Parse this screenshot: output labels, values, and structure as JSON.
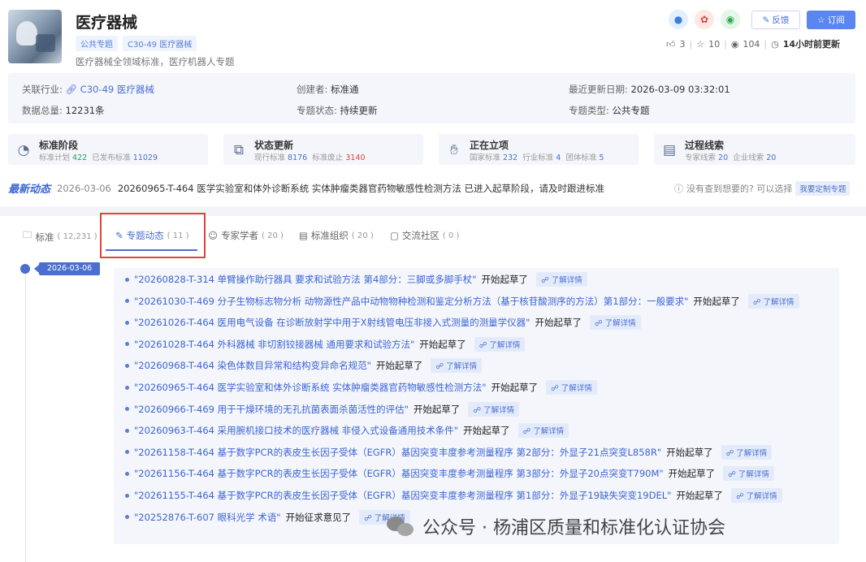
{
  "header": {
    "title": "医疗器械",
    "tags": [
      "公共专题",
      "C30-49 医疗器械"
    ],
    "subtitle": "医疗器械全领域标准，医疗机器人专题",
    "feedback_label": "反馈",
    "subscribe_label": "订阅",
    "likes": "3",
    "stars": "10",
    "views": "104",
    "updated": "14小时前更新"
  },
  "info": {
    "industry_label": "关联行业:",
    "industry_value": "C30-49 医疗器械",
    "creator_label": "创建者:",
    "creator_value": "标准通",
    "last_update_label": "最近更新日期:",
    "last_update_value": "2026-03-09 03:32:01",
    "total_label": "数据总量:",
    "total_value": "12231条",
    "status_label": "专题状态:",
    "status_value": "持续更新",
    "type_label": "专题类型:",
    "type_value": "公共专题"
  },
  "cards": [
    {
      "title": "标准阶段",
      "a_label": "标准计划",
      "a_value": "422",
      "b_label": "已发布标准",
      "b_value": "11029",
      "icon": "pie-chart-icon"
    },
    {
      "title": "状态更新",
      "a_label": "现行标准",
      "a_value": "8176",
      "b_label": "标准废止",
      "b_value": "3140",
      "icon": "switch-icon"
    },
    {
      "title": "正在立项",
      "a_label": "国家标准",
      "a_value": "232",
      "b_label": "行业标准",
      "b_value": "4",
      "c_label": "团体标准",
      "c_value": "5",
      "icon": "hand-icon"
    },
    {
      "title": "过程线索",
      "a_label": "专家线索",
      "a_value": "20",
      "b_label": "企业线索",
      "b_value": "20",
      "icon": "clue-icon"
    }
  ],
  "news": {
    "label": "最新动态",
    "date": "2026-03-06",
    "text": "20260965-T-464 医学实验室和体外诊断系统 实体肿瘤类器官药物敏感性检测方法 已进入起草阶段，请及时跟进标准",
    "help": "没有查到想要的? 可以选择",
    "custom": "我要定制专题"
  },
  "tabs": [
    {
      "label": "标准",
      "count": "( 12,231 )"
    },
    {
      "label": "专题动态",
      "count": "( 11 )"
    },
    {
      "label": "专家学者",
      "count": "( 20 )"
    },
    {
      "label": "标准组织",
      "count": "( 20 )"
    },
    {
      "label": "交流社区",
      "count": "( 0 )"
    }
  ],
  "timeline": {
    "date": "2026-03-06",
    "more_label": "了解详情",
    "items": [
      {
        "name": "\"20260828-T-314 单臂操作助行器具 要求和试验方法 第4部分：三脚或多脚手杖\"",
        "action": "开始起草了"
      },
      {
        "name": "\"20261030-T-469 分子生物标志物分析 动物源性产品中动物物种检测和鉴定分析方法（基于核苷酸测序的方法）第1部分：一般要求\"",
        "action": "开始起草了"
      },
      {
        "name": "\"20261026-T-464 医用电气设备 在诊断放射学中用于X射线管电压非接入式测量的测量学仪器\"",
        "action": "开始起草了"
      },
      {
        "name": "\"20261028-T-464 外科器械 非切割铰接器械 通用要求和试验方法\"",
        "action": "开始起草了"
      },
      {
        "name": "\"20260968-T-464 染色体数目异常和结构变异命名规范\"",
        "action": "开始起草了"
      },
      {
        "name": "\"20260965-T-464 医学实验室和体外诊断系统 实体肿瘤类器官药物敏感性检测方法\"",
        "action": "开始起草了"
      },
      {
        "name": "\"20260966-T-469 用于干燥环境的无孔抗菌表面杀菌活性的评估\"",
        "action": "开始起草了"
      },
      {
        "name": "\"20260963-T-464 采用腕机接口技术的医疗器械 非侵入式设备通用技术条件\"",
        "action": "开始起草了"
      },
      {
        "name": "\"20261158-T-464 基于数字PCR的表皮生长因子受体（EGFR）基因突变丰度参考测量程序 第2部分：外显子21点突变L858R\"",
        "action": "开始起草了"
      },
      {
        "name": "\"20261156-T-464 基于数字PCR的表皮生长因子受体（EGFR）基因突变丰度参考测量程序 第3部分：外显子20点突变T790M\"",
        "action": "开始起草了"
      },
      {
        "name": "\"20261155-T-464 基于数字PCR的表皮生长因子受体（EGFR）基因突变丰度参考测量程序 第1部分：外显子19缺失突变19DEL\"",
        "action": "开始起草了"
      },
      {
        "name": "\"20252876-T-607 眼科光学 术语\"",
        "action": "开始征求意见了"
      }
    ]
  },
  "watermark": "公众号 · 杨浦区质量和标准化认证协会"
}
